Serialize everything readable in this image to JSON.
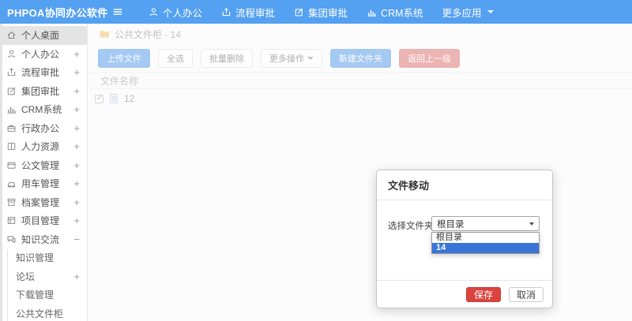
{
  "app": {
    "title": "PHPOA协同办公软件"
  },
  "header": {
    "nav": [
      {
        "label": "个人办公",
        "icon": "user-icon"
      },
      {
        "label": "流程审批",
        "icon": "process-icon"
      },
      {
        "label": "集团审批",
        "icon": "edit-icon"
      },
      {
        "label": "CRM系统",
        "icon": "chart-icon"
      },
      {
        "label": "更多应用",
        "icon": "caret-down-icon"
      }
    ]
  },
  "sidebar": {
    "items": [
      {
        "label": "个人桌面",
        "expand": "",
        "active": true
      },
      {
        "label": "个人办公",
        "expand": "+"
      },
      {
        "label": "流程审批",
        "expand": "+"
      },
      {
        "label": "集团审批",
        "expand": "+"
      },
      {
        "label": "CRM系统",
        "expand": "+"
      },
      {
        "label": "行政办公",
        "expand": "+"
      },
      {
        "label": "人力资源",
        "expand": "+"
      },
      {
        "label": "公文管理",
        "expand": "+"
      },
      {
        "label": "用车管理",
        "expand": "+"
      },
      {
        "label": "档案管理",
        "expand": "+"
      },
      {
        "label": "项目管理",
        "expand": "+"
      },
      {
        "label": "知识交流",
        "expand": "−"
      }
    ],
    "submenu": [
      {
        "label": "知识管理",
        "expand": ""
      },
      {
        "label": "论坛",
        "expand": "+"
      },
      {
        "label": "下载管理",
        "expand": ""
      },
      {
        "label": "公共文件柜",
        "expand": ""
      }
    ]
  },
  "content": {
    "breadcrumb": "公共文件柜 - 14",
    "toolbar": {
      "upload": "上传文件",
      "select_all": "全选",
      "batch_delete": "批量删除",
      "more": "更多操作",
      "new_folder": "新建文件夹",
      "back": "返回上一级"
    },
    "table": {
      "name_header": "文件名称"
    },
    "files": [
      {
        "name": "12",
        "checked": true
      }
    ]
  },
  "modal": {
    "title": "文件移动",
    "field_label": "选择文件夹",
    "select_value": "根目录",
    "options": [
      {
        "label": "根目录",
        "selected": false
      },
      {
        "label": "14",
        "selected": true
      }
    ],
    "save": "保存",
    "cancel": "取消"
  },
  "colors": {
    "header_blue": "#54a0f1",
    "accent_blue": "#4e97e9",
    "toolbar_red": "#de6f6a",
    "danger_red": "#d9443f",
    "option_highlight": "#3875d7",
    "folder_yellow": "#f1c06c"
  }
}
